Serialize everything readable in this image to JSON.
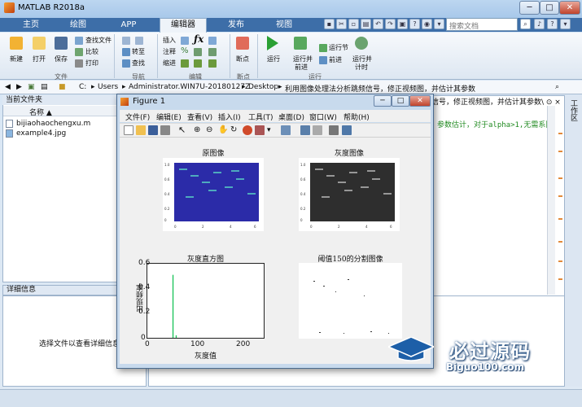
{
  "window": {
    "title": "MATLAB R2018a",
    "min": "─",
    "max": "□",
    "close": "✕"
  },
  "tabs": [
    {
      "label": "主页"
    },
    {
      "label": "绘图"
    },
    {
      "label": "APP"
    },
    {
      "label": "编辑器"
    },
    {
      "label": "发布"
    },
    {
      "label": "视图"
    }
  ],
  "search": {
    "placeholder": "搜索文档"
  },
  "ribbon": {
    "file_group": {
      "new": "新建",
      "open": "打开",
      "save": "保存",
      "find_files": "查找文件",
      "compare": "比较",
      "print": "打印",
      "label": "文件"
    },
    "nav_group": {
      "goto": "转至",
      "find": "查找",
      "label": "导航"
    },
    "edit_group": {
      "insert": "插入",
      "comment": "注释",
      "indent": "缩进",
      "label": "编辑"
    },
    "bp_group": {
      "breakpoints": "断点",
      "label": "断点"
    },
    "run_group": {
      "run": "运行",
      "run_advance_1": "运行并",
      "run_advance_2": "前进",
      "run_section": "运行节",
      "advance": "前进",
      "run_time_1": "运行并",
      "run_time_2": "计时",
      "label": "运行"
    }
  },
  "address": {
    "crumbs": [
      "C:",
      "Users",
      "Administrator.WIN7U-20180127Z",
      "Desktop",
      "利用图像处理法分析跳频信号，修正视频图，并估计其参数"
    ]
  },
  "current_folder": {
    "title": "当前文件夹",
    "column": "名称 ▲",
    "files": [
      {
        "name": "bijiaohaochengxu.m"
      },
      {
        "name": "example4.jpg"
      }
    ]
  },
  "details": {
    "title": "详细信息",
    "empty_text": "选择文件以查看详细信息"
  },
  "editor": {
    "tab_text": "信号，修正视频图，并估计其参数\\ ⊙ ×",
    "code": "参数估计，对于alpha>1,无需系除"
  },
  "right_panel": {
    "label": "工作区"
  },
  "figure": {
    "title": "Figure 1",
    "menus": [
      "文件(F)",
      "编辑(E)",
      "查看(V)",
      "插入(I)",
      "工具(T)",
      "桌面(D)",
      "窗口(W)",
      "帮助(H)"
    ],
    "subplots": {
      "original": "原图像",
      "gray": "灰度图像",
      "hist": "灰度直方图",
      "seg": "阈值150的分割图像"
    },
    "hist_ylabel": "出现频率",
    "hist_xlabel": "灰度值"
  },
  "chart_data": {
    "type": "bar",
    "title": "灰度直方图",
    "xlabel": "灰度值",
    "ylabel": "出现频率",
    "xlim": [
      0,
      255
    ],
    "ylim": [
      0,
      0.6
    ],
    "xticks": [
      "0",
      "100",
      "200"
    ],
    "yticks": [
      "0",
      "0.2",
      "0.4",
      "0.6"
    ],
    "x": [
      55,
      62
    ],
    "values": [
      0.51,
      0.02
    ],
    "color": "#22c55e"
  },
  "watermark": {
    "text": "必过源码",
    "url": "Biguo100.com"
  },
  "colors": {
    "accent": "#3d6ea8",
    "spectrogram_bg": "#2a2aa0",
    "gray_bg": "#2b2b2b"
  }
}
